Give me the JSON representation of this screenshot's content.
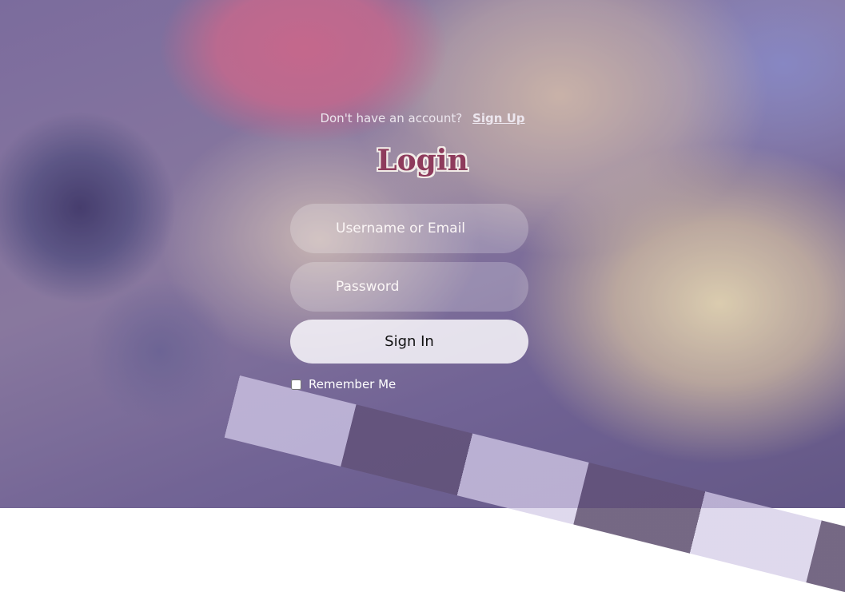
{
  "signup_prompt": {
    "text": "Don't have an account?",
    "link": "Sign Up"
  },
  "title": "Login",
  "form": {
    "username_placeholder": "Username or Email",
    "username_value": "",
    "password_placeholder": "Password",
    "password_value": "",
    "submit_label": "Sign In",
    "remember_label": "Remember Me",
    "remember_checked": false
  },
  "colors": {
    "title": "#8e3b5c",
    "button_bg": "#f5f2f8"
  }
}
